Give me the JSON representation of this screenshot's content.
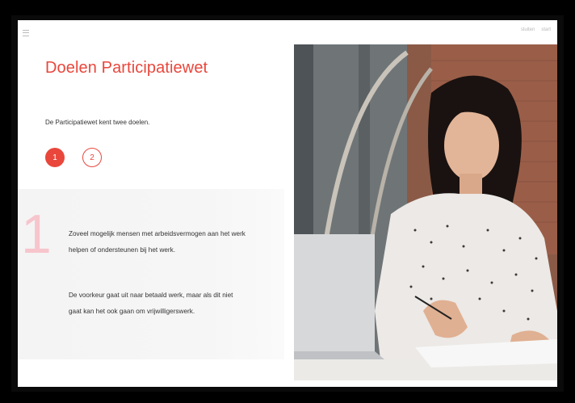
{
  "header": {
    "right_links": [
      "sluiten",
      "start"
    ]
  },
  "slide": {
    "title": "Doelen Participatiewet",
    "intro": "De Participatiewet kent twee doelen.",
    "steps": [
      {
        "label": "1",
        "active": true
      },
      {
        "label": "2",
        "active": false
      }
    ],
    "panel": {
      "number": "1",
      "paragraph_1": "Zoveel mogelijk mensen met arbeidsvermogen aan het werk helpen of ondersteunen bij het werk.",
      "paragraph_2": "De voorkeur gaat uit naar betaald werk, maar als dit niet gaat kan het ook gaan om vrijwilligerswerk."
    }
  },
  "colors": {
    "accent": "#e9473c",
    "big_number": "#f7c5cc",
    "panel_bg": "#f5f5f5"
  },
  "icons": [
    "menu-icon"
  ]
}
